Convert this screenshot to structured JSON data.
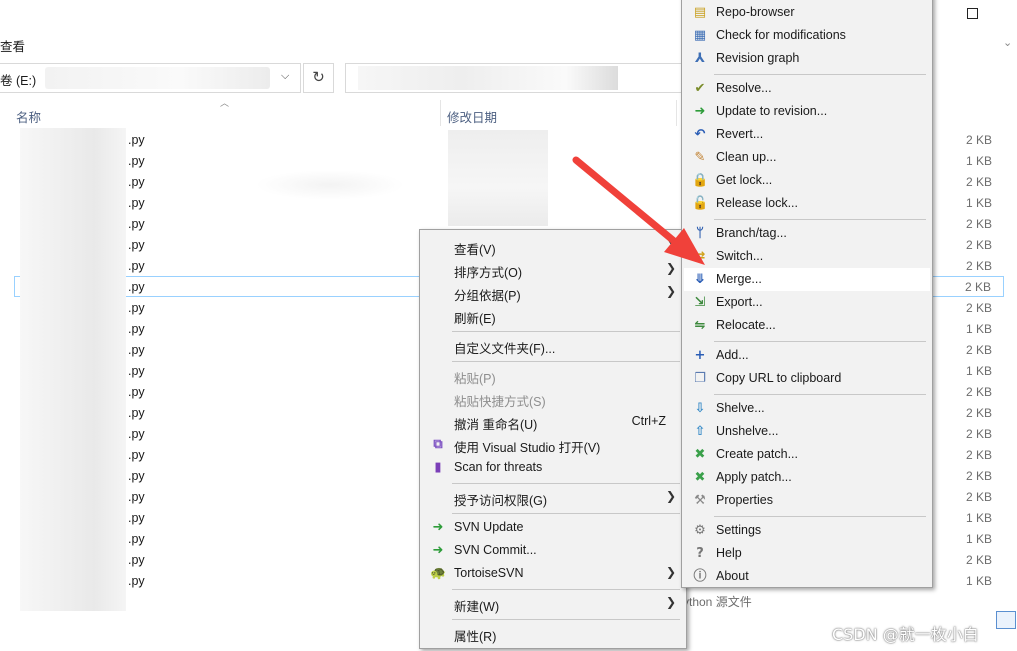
{
  "explorer": {
    "ribbon_tab": "查看",
    "address_drive": "卷 (E:)",
    "refresh_glyph": "↻",
    "columns": {
      "name": "名称",
      "date_modified": "修改日期"
    },
    "files": [
      {
        "name": ".py",
        "size": "2 KB"
      },
      {
        "name": ".py",
        "size": "1 KB"
      },
      {
        "name": ".py",
        "size": "2 KB"
      },
      {
        "name": ".py",
        "size": "1 KB"
      },
      {
        "name": ".py",
        "size": "2 KB"
      },
      {
        "name": ".py",
        "size": "2 KB"
      },
      {
        "name": ".py",
        "size": "2 KB"
      },
      {
        "name": ".py",
        "size": "2 KB"
      },
      {
        "name": ".py",
        "size": "2 KB"
      },
      {
        "name": ".py",
        "size": "1 KB"
      },
      {
        "name": ".py",
        "size": "2 KB"
      },
      {
        "name": ".py",
        "size": "1 KB"
      },
      {
        "name": ".py",
        "size": "2 KB"
      },
      {
        "name": ".py",
        "size": "2 KB"
      },
      {
        "name": ".py",
        "size": "2 KB"
      },
      {
        "name": ".py",
        "size": "2 KB"
      },
      {
        "name": ".py",
        "size": "2 KB"
      },
      {
        "name": ".py",
        "size": "2 KB"
      },
      {
        "name": ".py",
        "size": "1 KB"
      },
      {
        "name": ".py",
        "size": "1 KB"
      },
      {
        "name": ".py",
        "size": "2 KB"
      },
      {
        "name": ".py",
        "size": "1 KB"
      }
    ],
    "last_row_type": "ython 源文件"
  },
  "context_menu": {
    "items": [
      {
        "label": "查看(V)",
        "submenu": true
      },
      {
        "label": "排序方式(O)",
        "submenu": true
      },
      {
        "label": "分组依据(P)",
        "submenu": true
      },
      {
        "label": "刷新(E)"
      },
      {
        "label": "自定义文件夹(F)..."
      },
      {
        "label": "粘贴(P)",
        "disabled": true
      },
      {
        "label": "粘贴快捷方式(S)",
        "disabled": true
      },
      {
        "label": "撤消 重命名(U)",
        "shortcut": "Ctrl+Z"
      },
      {
        "label": "使用 Visual Studio 打开(V)",
        "icon": "visual-studio-icon"
      },
      {
        "label": "Scan for threats",
        "icon": "shield-scan-icon"
      },
      {
        "label": "授予访问权限(G)",
        "submenu": true
      },
      {
        "label": "SVN Update",
        "icon": "svn-update-icon"
      },
      {
        "label": "SVN Commit...",
        "icon": "svn-commit-icon"
      },
      {
        "label": "TortoiseSVN",
        "icon": "tortoisesvn-icon",
        "submenu": true
      },
      {
        "label": "新建(W)",
        "submenu": true
      },
      {
        "label": "属性(R)"
      }
    ]
  },
  "tortoise_menu": {
    "items": [
      {
        "label": "Repo-browser",
        "icon": "repo-browser-icon"
      },
      {
        "label": "Check for modifications",
        "icon": "check-modifications-icon"
      },
      {
        "label": "Revision graph",
        "icon": "revision-graph-icon"
      },
      {
        "label": "Resolve...",
        "icon": "resolve-icon"
      },
      {
        "label": "Update to revision...",
        "icon": "update-revision-icon"
      },
      {
        "label": "Revert...",
        "icon": "revert-icon"
      },
      {
        "label": "Clean up...",
        "icon": "cleanup-icon"
      },
      {
        "label": "Get lock...",
        "icon": "lock-icon"
      },
      {
        "label": "Release lock...",
        "icon": "unlock-icon"
      },
      {
        "label": "Branch/tag...",
        "icon": "branch-icon"
      },
      {
        "label": "Switch...",
        "icon": "switch-icon"
      },
      {
        "label": "Merge...",
        "icon": "merge-icon",
        "highlighted": true
      },
      {
        "label": "Export...",
        "icon": "export-icon"
      },
      {
        "label": "Relocate...",
        "icon": "relocate-icon"
      },
      {
        "label": "Add...",
        "icon": "add-icon"
      },
      {
        "label": "Copy URL to clipboard",
        "icon": "copy-url-icon"
      },
      {
        "label": "Shelve...",
        "icon": "shelve-icon"
      },
      {
        "label": "Unshelve...",
        "icon": "unshelve-icon"
      },
      {
        "label": "Create patch...",
        "icon": "create-patch-icon"
      },
      {
        "label": "Apply patch...",
        "icon": "apply-patch-icon"
      },
      {
        "label": "Properties",
        "icon": "properties-icon"
      },
      {
        "label": "Settings",
        "icon": "settings-icon"
      },
      {
        "label": "Help",
        "icon": "help-icon"
      },
      {
        "label": "About",
        "icon": "about-icon"
      }
    ]
  },
  "annotation": {
    "arrow_color": "#f0413a"
  },
  "watermark": "CSDN @就一枚小白"
}
